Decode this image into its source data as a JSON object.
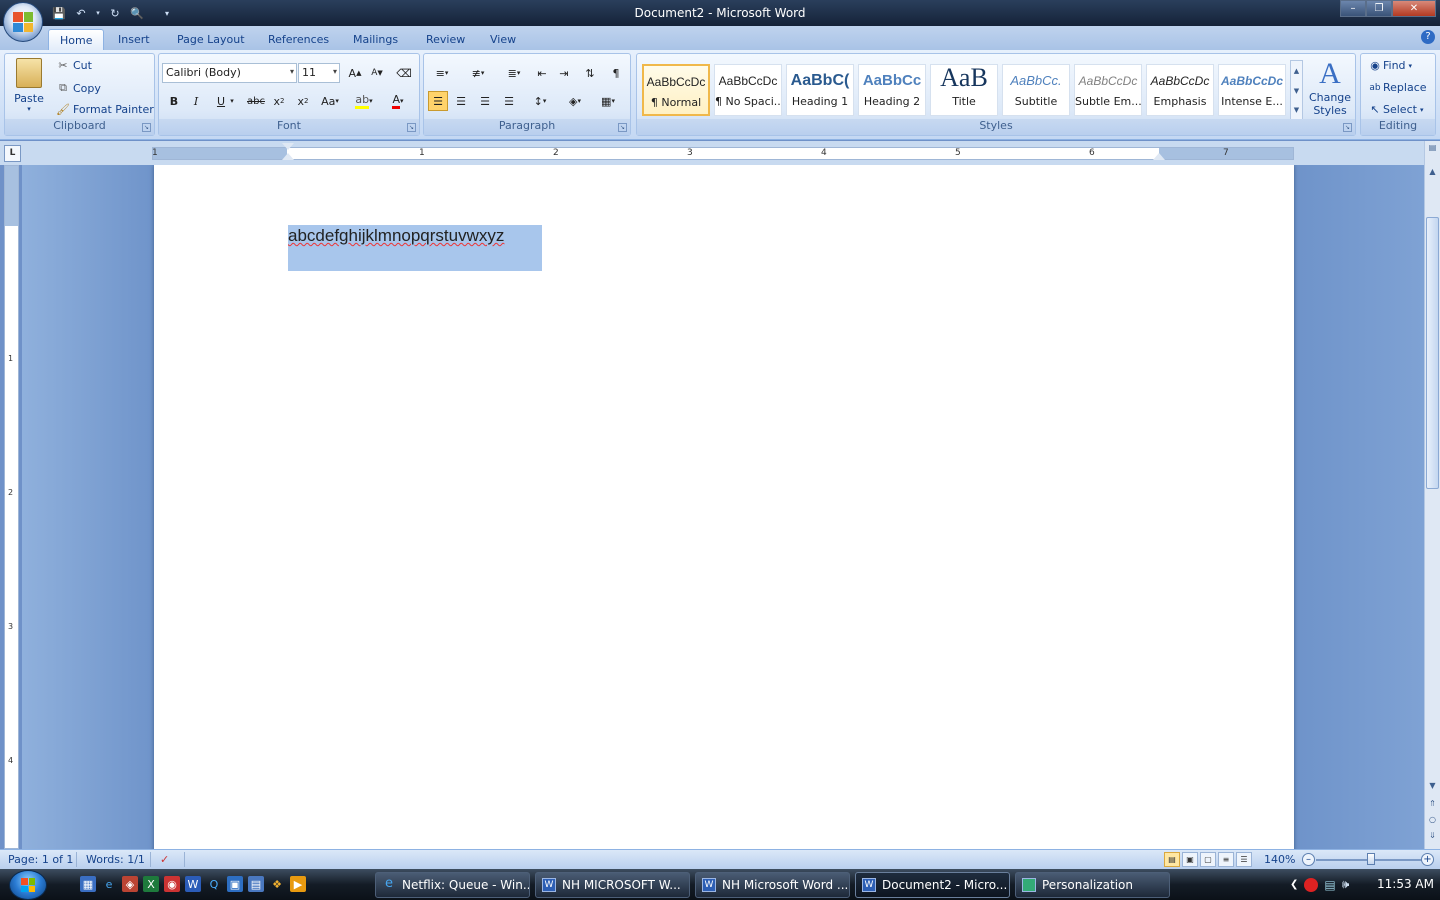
{
  "window": {
    "title": "Document2 - Microsoft Word"
  },
  "tabs": [
    "Home",
    "Insert",
    "Page Layout",
    "References",
    "Mailings",
    "Review",
    "View"
  ],
  "clipboard": {
    "paste": "Paste",
    "cut": "Cut",
    "copy": "Copy",
    "format_painter": "Format Painter",
    "label": "Clipboard"
  },
  "font": {
    "name": "Calibri (Body)",
    "size": "11",
    "label": "Font"
  },
  "paragraph": {
    "label": "Paragraph"
  },
  "styles": {
    "label": "Styles",
    "items": [
      {
        "preview": "AaBbCcDc",
        "label": "¶ Normal"
      },
      {
        "preview": "AaBbCcDc",
        "label": "¶ No Spaci..."
      },
      {
        "preview": "AaBbC(",
        "label": "Heading 1"
      },
      {
        "preview": "AaBbCc",
        "label": "Heading 2"
      },
      {
        "preview": "AaB",
        "label": "Title"
      },
      {
        "preview": "AaBbCc.",
        "label": "Subtitle"
      },
      {
        "preview": "AaBbCcDc",
        "label": "Subtle Em..."
      },
      {
        "preview": "AaBbCcDc",
        "label": "Emphasis"
      },
      {
        "preview": "AaBbCcDc",
        "label": "Intense E..."
      }
    ],
    "change_styles_line1": "Change",
    "change_styles_line2": "Styles"
  },
  "editing": {
    "find": "Find",
    "replace": "Replace",
    "select": "Select",
    "label": "Editing"
  },
  "ruler": {
    "h_numbers": [
      "1",
      "1",
      "2",
      "3",
      "4",
      "5",
      "6",
      "7"
    ],
    "v_numbers": [
      "1",
      "2",
      "3",
      "4"
    ]
  },
  "document": {
    "text": "abcdefghijklmnopqrstuvwxyz"
  },
  "status": {
    "page": "Page: 1 of 1",
    "words": "Words: 1/1",
    "zoom": "140%"
  },
  "taskbar": {
    "tasks": [
      {
        "label": "Netflix: Queue - Win...",
        "active": false
      },
      {
        "label": "NH MICROSOFT W...",
        "active": false
      },
      {
        "label": "NH Microsoft Word ...",
        "active": false
      },
      {
        "label": "Document2 - Micro...",
        "active": true
      },
      {
        "label": "Personalization",
        "active": false
      }
    ],
    "clock": "11:53 AM"
  }
}
